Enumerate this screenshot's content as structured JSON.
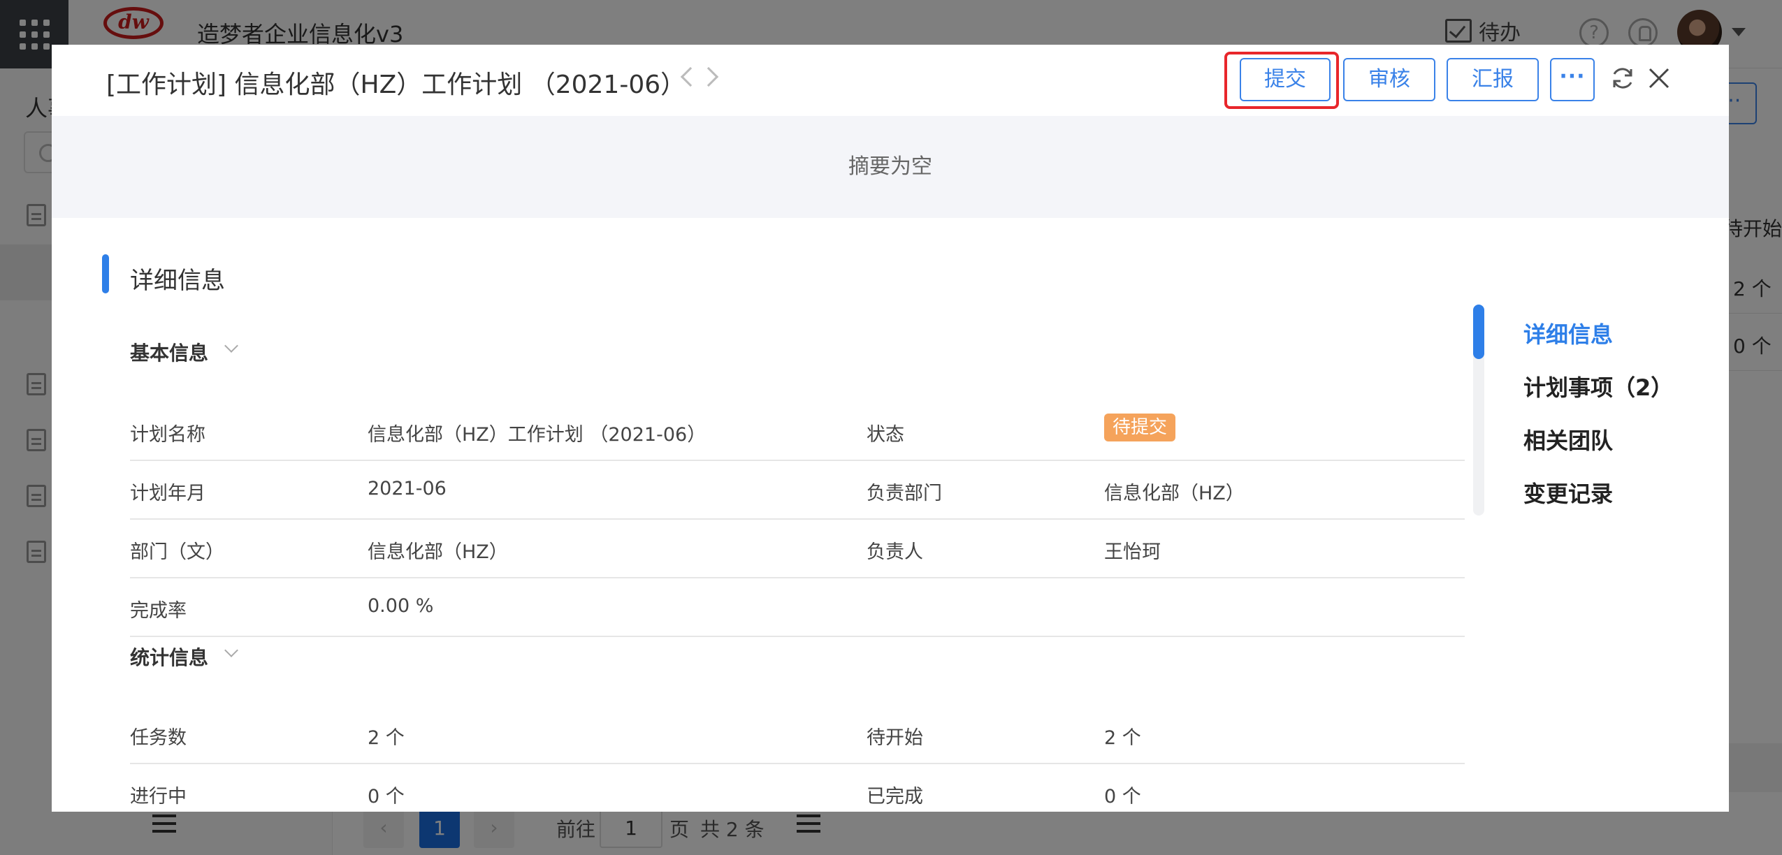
{
  "app": {
    "name": "造梦者企业信息化v3",
    "todo_label": "待办",
    "help_symbol": "?"
  },
  "background": {
    "sidebar_title": "人事",
    "more_symbol": "···",
    "column_header": "待开始",
    "cells": [
      "2 个",
      "0 个"
    ],
    "pager": {
      "current": "1",
      "goto_label": "前往",
      "goto_value": "1",
      "page_label": "页",
      "total_label": "共 2 条"
    }
  },
  "modal": {
    "title": "[工作计划] 信息化部（HZ）工作计划 （2021-06）",
    "buttons": {
      "submit": "提交",
      "review": "审核",
      "report": "汇报",
      "more": "···"
    },
    "summary": "摘要为空",
    "section_title": "详细信息",
    "basic": {
      "title": "基本信息",
      "rows": [
        {
          "label1": "计划名称",
          "value1": "信息化部（HZ）工作计划 （2021-06）",
          "label2": "状态",
          "value2": "待提交"
        },
        {
          "label1": "计划年月",
          "value1": "2021-06",
          "label2": "负责部门",
          "value2": "信息化部（HZ）"
        },
        {
          "label1": "部门（文）",
          "value1": "信息化部（HZ）",
          "label2": "负责人",
          "value2": "王怡珂"
        },
        {
          "label1": "完成率",
          "value1": "0.00 %",
          "label2": "",
          "value2": ""
        }
      ]
    },
    "stats": {
      "title": "统计信息",
      "rows": [
        {
          "label1": "任务数",
          "value1": "2 个",
          "label2": "待开始",
          "value2": "2 个"
        },
        {
          "label1": "进行中",
          "value1": "0 个",
          "label2": "已完成",
          "value2": "0 个"
        }
      ]
    },
    "anchors": [
      "详细信息",
      "计划事项（2）",
      "相关团队",
      "变更记录"
    ]
  },
  "colors": {
    "accent": "#2e7fe8",
    "highlight": "#e8262b",
    "status_badge": "#f5a35b"
  }
}
